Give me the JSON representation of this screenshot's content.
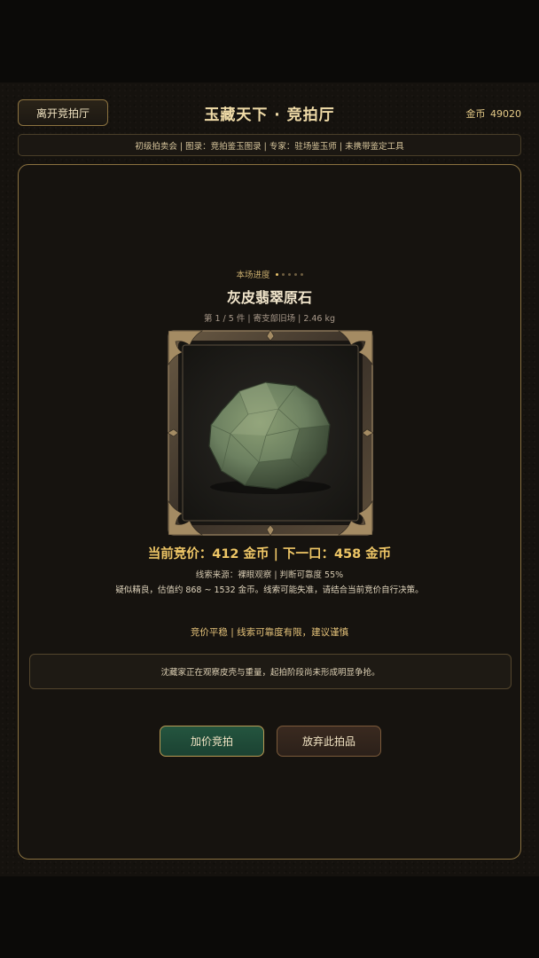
{
  "header": {
    "leave_label": "离开竞拍厅",
    "title": "玉藏天下 · 竞拍厅",
    "gold_label": "金币",
    "gold_value": "49020"
  },
  "info_bar": {
    "text": "初级拍卖会 | 图录：竞拍鉴玉图录 | 专家：驻场鉴玉师 | 未携带鉴定工具"
  },
  "auction": {
    "progress_label": "本场进度",
    "progress_total": 5,
    "progress_current": 1,
    "item_name": "灰皮翡翠原石",
    "item_meta": "第 1 / 5 件 | 寄支部旧场 | 2.46 kg",
    "bid_line": "当前竞价：412 金币 | 下一口：458 金币",
    "clue_line": "线索来源：裸眼观察 | 判断可靠度 55%",
    "estimate_line": "疑似精良，估值约 868 ~ 1532 金币。线索可能失准，请结合当前竞价自行决策。",
    "market_line": "竞价平稳 | 线索可靠度有限，建议谨慎",
    "message": "沈藏家正在观察皮壳与重量，起拍阶段尚未形成明显争抢。"
  },
  "actions": {
    "raise_label": "加价竞拍",
    "quit_label": "放弃此拍品"
  },
  "colors": {
    "accent_gold": "#eec666",
    "panel_border": "#8a7140",
    "raise_button": "#1f4a37",
    "quit_button": "#33251c",
    "stone": "#6f8560"
  },
  "icons": {
    "frame_ornament": "ornate-corner-icon",
    "stone": "jade-stone-icon"
  }
}
